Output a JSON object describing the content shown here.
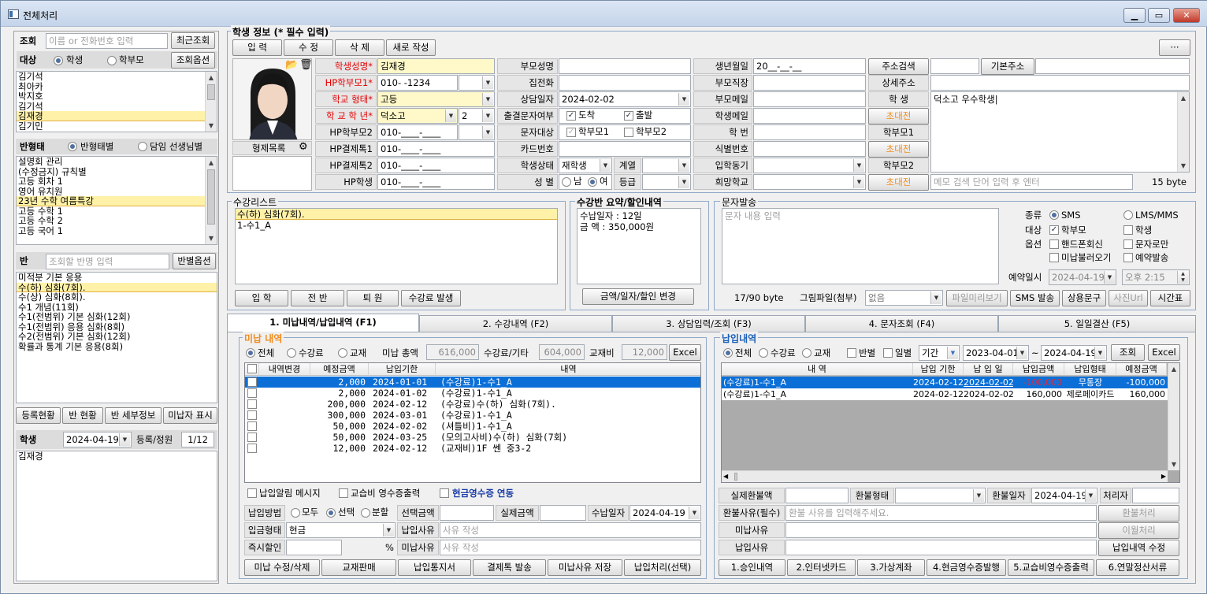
{
  "window": {
    "title": "전체처리",
    "min": "▁",
    "max": "▭",
    "close": "✕"
  },
  "left": {
    "search": {
      "label": "조회",
      "placeholder": "이름 or 전화번호 입력",
      "recent_btn": "최근조회"
    },
    "target": {
      "label": "대상",
      "opt_student": "학생",
      "opt_parent": "학부모",
      "options_btn": "조회옵션"
    },
    "students": [
      "김기석",
      "최아카",
      "박지호",
      "김기석",
      "김재경",
      "김기민"
    ],
    "class_type": {
      "label": "반형태",
      "opt1": "반형태별",
      "opt2": "담임 선생님별"
    },
    "class_types": [
      "설명회 관리",
      "(수정금지) 규칙별",
      "고등 회차 1",
      "영어 유치원",
      "23년 수학 여름특강",
      "고등 수학 1",
      "고등 수학 2",
      "고등 국어 1"
    ],
    "class": {
      "label": "반",
      "placeholder": "조회할 반명 입력",
      "options_btn": "반별옵션"
    },
    "classes": [
      "미적분 기본 응용",
      "수(하) 심화(7회).",
      "수(상) 심화(8회).",
      "수1 개념(11회)",
      "수1(전범위) 기본 심화(12회)",
      "수1(전범위) 응용 심화(8회)",
      "수2(전범위) 기본 심화(12회)",
      "확률과 통계 기본 응용(8회)"
    ],
    "buttons": [
      "등록현황",
      "반 현황",
      "반 세부정보",
      "미납자 표시"
    ],
    "student_box": {
      "label": "학생",
      "date": "2024-04-19",
      "reg_label": "등록/정원",
      "reg_value": "1/12"
    },
    "student_list": [
      "김재경"
    ]
  },
  "info": {
    "title": "학생 정보 (* 필수 입력)",
    "buttons": [
      "입 력",
      "수 정",
      "삭 제",
      "새로 작성"
    ],
    "more": "···",
    "sibling_label": "형제목록",
    "col1": [
      {
        "label": "학생성명*",
        "value": "김재경",
        "red": true
      },
      {
        "label": "HP학부모1*",
        "value": "010-      -1234",
        "red": true
      },
      {
        "label": "학교 형태*",
        "value": "고등",
        "red": true
      },
      {
        "label": "학 교 학 년*",
        "value": "덕소고",
        "extra": "2",
        "red": true
      },
      {
        "label": "HP학부모2",
        "value": "010-____-____"
      },
      {
        "label": "HP결제톡1",
        "value": "010-____-____"
      },
      {
        "label": "HP결제톡2",
        "value": "010-____-____"
      },
      {
        "label": "HP학생",
        "value": "010-____-____"
      }
    ],
    "col2": [
      {
        "label": "부모성명",
        "value": ""
      },
      {
        "label": "집전화",
        "value": ""
      },
      {
        "label": "상담일자",
        "value": "2024-02-02"
      },
      {
        "label": "출결문자여부",
        "value": ""
      },
      {
        "label": "문자대상",
        "value": ""
      },
      {
        "label": "카드번호",
        "value": ""
      },
      {
        "label": "학생상태",
        "value": "재학생"
      },
      {
        "label": "성 별",
        "value": ""
      }
    ],
    "attend": {
      "a": "도착",
      "b": "출발"
    },
    "sms_target": {
      "a": "학부모1",
      "b": "학부모2"
    },
    "series_label": "계열",
    "grade_label": "등급",
    "gender": {
      "m": "남",
      "f": "여"
    },
    "col3": [
      {
        "label": "생년월일",
        "value": "20__-__-__"
      },
      {
        "label": "부모직장",
        "value": ""
      },
      {
        "label": "부모메일",
        "value": ""
      },
      {
        "label": "학생메일",
        "value": ""
      },
      {
        "label": "학 번",
        "value": ""
      },
      {
        "label": "식별번호",
        "value": ""
      },
      {
        "label": "입학동기",
        "value": ""
      },
      {
        "label": "희망학교",
        "value": ""
      }
    ],
    "col4": [
      {
        "label": "주소검색",
        "value": ""
      },
      {
        "label": "상세주소",
        "value": ""
      },
      {
        "label": "학 생",
        "value": "덕소고 우수학생|"
      },
      {
        "label": "초대전",
        "value": ""
      },
      {
        "label": "학부모1",
        "value": ""
      },
      {
        "label": "초대전",
        "value": ""
      },
      {
        "label": "학부모2",
        "value": ""
      },
      {
        "label": "초대전",
        "value": ""
      }
    ],
    "base_addr_btn": "기본주소",
    "memo_placeholder": "메모 검색 단어 입력 후 엔터",
    "bytes": "15 byte"
  },
  "course": {
    "title": "수강리스트",
    "items": [
      "수(하) 심화(7회).",
      "1-수1_A"
    ],
    "buttons": [
      "입 학",
      "전 반",
      "퇴 원",
      "수강료 발생"
    ]
  },
  "summary": {
    "title": "수강반 요약/할인내역",
    "line1": "수납일자 : 12일",
    "line2": "금      액 : 350,000원",
    "btn": "금액/일자/할인 변경"
  },
  "sms": {
    "title": "문자발송",
    "placeholder": "문자 내용 입력",
    "kind": "종류",
    "sms": "SMS",
    "lms": "LMS/MMS",
    "target": "대상",
    "parent": "학부모",
    "student": "학생",
    "option": "옵션",
    "o1": "핸드폰회신",
    "o2": "문자로만",
    "o3": "미납불러오기",
    "o4": "예약발송",
    "reserve_label": "예약일시",
    "reserve_date": "2024-04-19",
    "reserve_time": "오후  2:15",
    "bytes": "17/90 byte",
    "attach_label": "그림파일(첨부)",
    "attach_value": "없음",
    "btns": [
      "파일미리보기",
      "SMS 발송",
      "상용문구",
      "사진Url",
      "시간표"
    ]
  },
  "tabs": [
    "1. 미납내역/납입내역 (F1)",
    "2. 수강내역 (F2)",
    "3. 상담입력/조회 (F3)",
    "4. 문자조회 (F4)",
    "5. 일일결산 (F5)"
  ],
  "unpaid": {
    "title": "미납 내역",
    "filter": {
      "all": "전체",
      "fee": "수강료",
      "mat": "교재"
    },
    "total_label": "미납 총액",
    "total": "616,000",
    "fee_label": "수강료/기타",
    "fee": "604,000",
    "mat_label": "교재비",
    "mat": "12,000",
    "excel": "Excel",
    "headers": [
      "",
      "내역변경",
      "예정금액",
      "납입기한",
      "내역"
    ],
    "rows": [
      {
        "amt": "2,000",
        "due": "2024-01-01",
        "desc": "(수강료)1-수1_A"
      },
      {
        "amt": "2,000",
        "due": "2024-01-02",
        "desc": "(수강료)1-수1_A"
      },
      {
        "amt": "200,000",
        "due": "2024-02-12",
        "desc": "(수강료)수(하) 심화(7회)."
      },
      {
        "amt": "300,000",
        "due": "2024-03-01",
        "desc": "(수강료)1-수1_A"
      },
      {
        "amt": "50,000",
        "due": "2024-02-02",
        "desc": "(셔틀비)1-수1_A"
      },
      {
        "amt": "50,000",
        "due": "2024-03-25",
        "desc": "(모의고사비)수(하) 심화(7회)"
      },
      {
        "amt": "12,000",
        "due": "2024-02-12",
        "desc": "(교재비)1F 쎈 중3-2"
      }
    ],
    "chk1": "납입알림 메시지",
    "chk2": "교습비 영수증출력",
    "chk3": "현금영수증 연동",
    "pay_method": "납입방법",
    "pm_all": "모두",
    "pm_sel": "선택",
    "pm_split": "분할",
    "sel_amt": "선택금액",
    "real_amt": "실제금액",
    "recv_date_label": "수납일자",
    "recv_date": "2024-04-19",
    "pay_type_label": "입금형태",
    "pay_type": "현금",
    "pay_reason": "납입사유",
    "pay_reason_ph": "사유 작성",
    "disc_label": "즉시할인",
    "pct": "%",
    "unpaid_reason": "미납사유",
    "unpaid_reason_ph": "사유 작성",
    "buttons": [
      "미납 수정/삭제",
      "교재판매",
      "납입통지서",
      "결제톡 발송",
      "미납사유 저장",
      "납입처리(선택)"
    ]
  },
  "paid": {
    "title": "납입내역",
    "filter": {
      "all": "전체",
      "fee": "수강료",
      "mat": "교재"
    },
    "c1": "반별",
    "c2": "일별",
    "period": "기간",
    "from": "2023-04-01",
    "tilde": "~",
    "to": "2024-04-19",
    "search": "조회",
    "excel": "Excel",
    "headers": [
      "내 역",
      "납입 기한",
      "납 입 일",
      "납입금액",
      "납입형태",
      "예정금액"
    ],
    "rows": [
      {
        "desc": "(수강료)1-수1_A",
        "due": "2024-02-12",
        "date": "2024-02-02",
        "amt": "-100,000",
        "type": "무통장",
        "plan": "-100,000"
      },
      {
        "desc": "(수강료)1-수1_A",
        "due": "2024-02-12",
        "date": "2024-02-02",
        "amt": "160,000",
        "type": "제로페이카드",
        "plan": "160,000"
      }
    ],
    "refund_amt": "실제환불액",
    "refund_type": "환불형태",
    "refund_date_label": "환불일자",
    "refund_date": "2024-04-19",
    "handler": "처리자",
    "refund_reason": "환불사유(필수)",
    "refund_reason_ph": "환불 사유를 입력해주세요.",
    "refund_btn": "환불처리",
    "unpaid_reason": "미납사유",
    "move_btn": "이월처리",
    "pay_reason": "납입사유",
    "edit_btn": "납입내역 수정",
    "buttons": [
      "1.승인내역",
      "2.인터넷카드",
      "3.가상계좌",
      "4.현금영수증발행",
      "5.교습비영수증출력",
      "6.연말정산서류"
    ]
  }
}
